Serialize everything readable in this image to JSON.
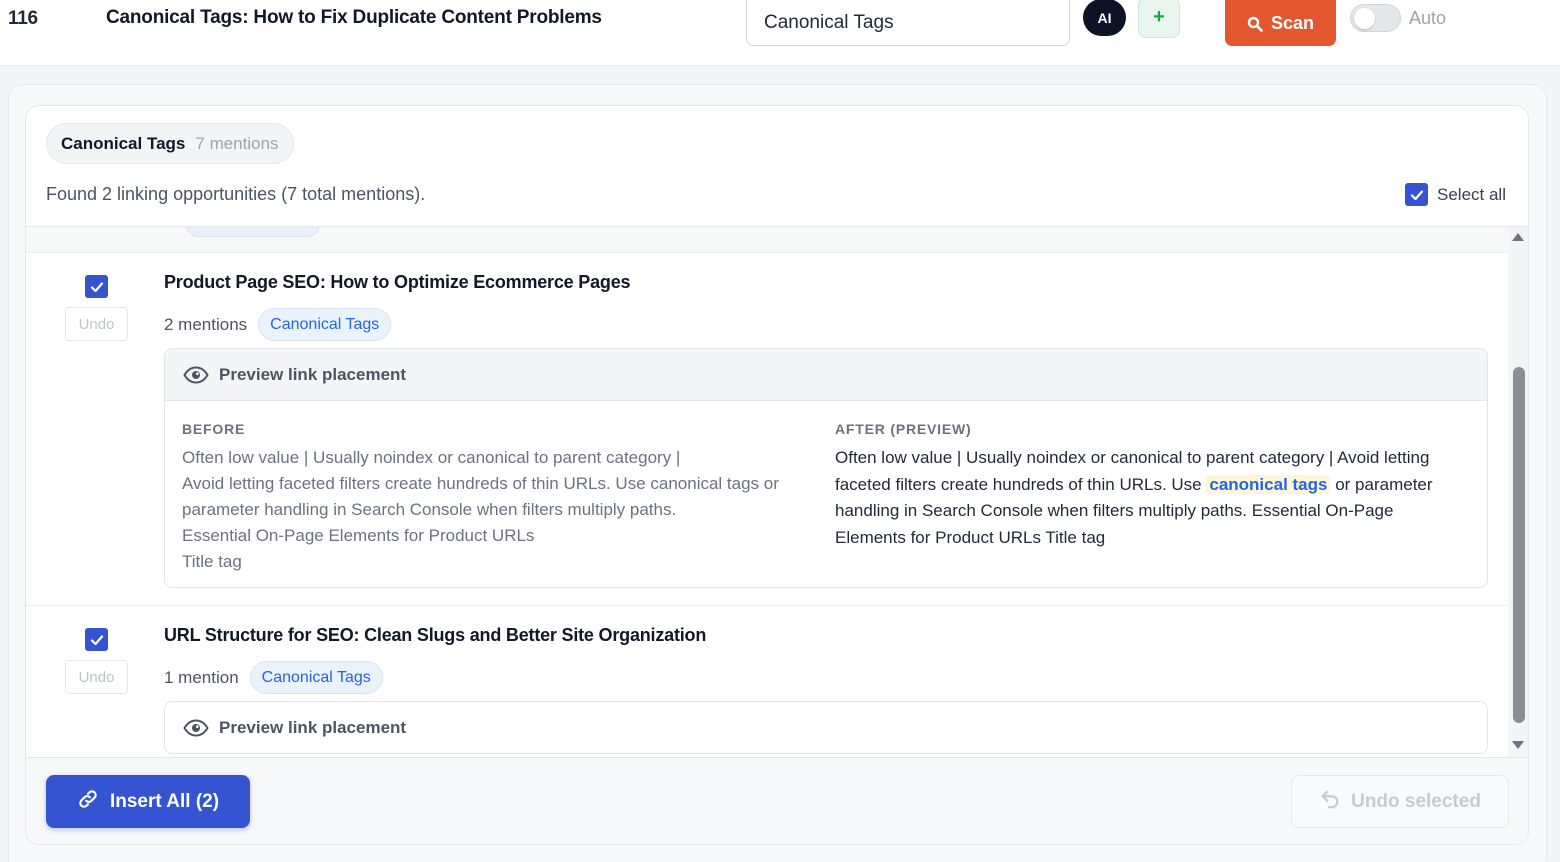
{
  "header": {
    "row_number": "116",
    "post_title": "Canonical Tags: How to Fix Duplicate Content Problems",
    "keyword_value": "Canonical Tags",
    "ai_label": "AI",
    "add_label": "+",
    "scan_label": "Scan",
    "auto_label": "Auto",
    "auto_enabled": false
  },
  "keyword_chip": {
    "name": "Canonical Tags",
    "count": "7 mentions"
  },
  "summary": {
    "found_text": "Found 2 linking opportunities (7 total mentions).",
    "select_all_label": "Select all",
    "select_all_checked": true
  },
  "items": [
    {
      "checked": true,
      "undo_label": "Undo",
      "title": "Product Page SEO: How to Optimize Ecommerce Pages",
      "mentions": "2 mentions",
      "keyword": "Canonical Tags",
      "preview_label": "Preview link placement",
      "before_label": "BEFORE",
      "after_label": "AFTER (PREVIEW)",
      "before_lines": [
        "Often low value | Usually noindex or canonical to parent category |",
        "Avoid letting faceted filters create hundreds of thin URLs. Use canonical tags or",
        "parameter handling in Search Console when filters multiply paths.",
        "Essential On-Page Elements for Product URLs",
        "Title tag"
      ],
      "after_prefix": "Often low value | Usually noindex or canonical to parent category | Avoid letting faceted filters create hundreds of thin URLs. Use",
      "after_link": "canonical tags",
      "after_suffix": "or parameter handling in Search Console when filters multiply paths. Essential On-Page Elements for Product URLs Title tag"
    },
    {
      "checked": true,
      "undo_label": "Undo",
      "title": "URL Structure for SEO: Clean Slugs and Better Site Organization",
      "mentions": "1 mention",
      "keyword": "Canonical Tags",
      "preview_label": "Preview link placement"
    }
  ],
  "footer": {
    "insert_all_label": "Insert All (2)",
    "undo_selected_label": "Undo selected"
  },
  "colors": {
    "primary": "#3454d1",
    "scan": "#e4572e",
    "link": "#2563eb",
    "highlight": "#fdf7d7"
  },
  "icons": [
    "search-icon",
    "eye-icon",
    "link-icon",
    "undo-icon",
    "check-icon",
    "scroll-up-icon",
    "scroll-down-icon"
  ]
}
